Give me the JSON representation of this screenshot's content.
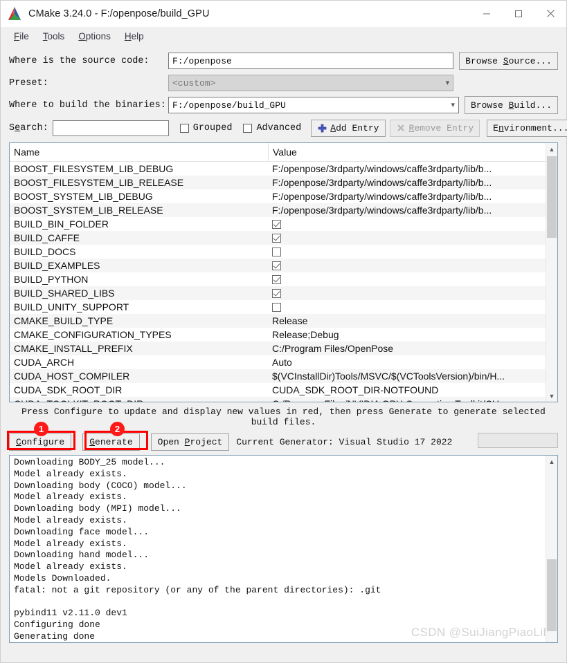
{
  "window": {
    "title": "CMake 3.24.0 - F:/openpose/build_GPU",
    "logo_icon": "cmake-logo-icon",
    "controls": [
      {
        "name": "minimize-button",
        "icon": "minimize-icon"
      },
      {
        "name": "maximize-button",
        "icon": "maximize-icon"
      },
      {
        "name": "close-button",
        "icon": "close-icon"
      }
    ]
  },
  "menubar": {
    "items": [
      {
        "label": "File",
        "mnemonic": "F"
      },
      {
        "label": "Tools",
        "mnemonic": "T"
      },
      {
        "label": "Options",
        "mnemonic": "O"
      },
      {
        "label": "Help",
        "mnemonic": "H"
      }
    ]
  },
  "form": {
    "source_label": "Where is the source code:",
    "source_value": "F:/openpose",
    "browse_source_label": "Browse Source...",
    "browse_source_mnemonic": "S",
    "preset_label": "Preset:",
    "preset_value": "<custom>",
    "build_label": "Where to build the binaries:",
    "build_value": "F:/openpose/build_GPU",
    "browse_build_label": "Browse Build...",
    "browse_build_mnemonic": "B",
    "search_label": "Search:",
    "search_mnemonic": "e",
    "search_value": "",
    "search_placeholder": "",
    "grouped_label": "Grouped",
    "grouped_checked": false,
    "advanced_label": "Advanced",
    "advanced_checked": false,
    "add_entry_label": "Add Entry",
    "add_entry_mnemonic": "A",
    "add_entry_icon": "plus-icon",
    "remove_entry_label": "Remove Entry",
    "remove_entry_mnemonic": "R",
    "remove_entry_icon": "remove-x-icon",
    "remove_entry_disabled": true,
    "environment_label": "Environment...",
    "environment_mnemonic": "n"
  },
  "cache_table": {
    "columns": [
      "Name",
      "Value"
    ],
    "rows": [
      {
        "name": "BOOST_FILESYSTEM_LIB_DEBUG",
        "type": "text",
        "value": "F:/openpose/3rdparty/windows/caffe3rdparty/lib/b..."
      },
      {
        "name": "BOOST_FILESYSTEM_LIB_RELEASE",
        "type": "text",
        "value": "F:/openpose/3rdparty/windows/caffe3rdparty/lib/b..."
      },
      {
        "name": "BOOST_SYSTEM_LIB_DEBUG",
        "type": "text",
        "value": "F:/openpose/3rdparty/windows/caffe3rdparty/lib/b..."
      },
      {
        "name": "BOOST_SYSTEM_LIB_RELEASE",
        "type": "text",
        "value": "F:/openpose/3rdparty/windows/caffe3rdparty/lib/b..."
      },
      {
        "name": "BUILD_BIN_FOLDER",
        "type": "checkbox",
        "value": true
      },
      {
        "name": "BUILD_CAFFE",
        "type": "checkbox",
        "value": true
      },
      {
        "name": "BUILD_DOCS",
        "type": "checkbox",
        "value": false
      },
      {
        "name": "BUILD_EXAMPLES",
        "type": "checkbox",
        "value": true
      },
      {
        "name": "BUILD_PYTHON",
        "type": "checkbox",
        "value": true
      },
      {
        "name": "BUILD_SHARED_LIBS",
        "type": "checkbox",
        "value": true
      },
      {
        "name": "BUILD_UNITY_SUPPORT",
        "type": "checkbox",
        "value": false
      },
      {
        "name": "CMAKE_BUILD_TYPE",
        "type": "text",
        "value": "Release"
      },
      {
        "name": "CMAKE_CONFIGURATION_TYPES",
        "type": "text",
        "value": "Release;Debug"
      },
      {
        "name": "CMAKE_INSTALL_PREFIX",
        "type": "text",
        "value": "C:/Program Files/OpenPose"
      },
      {
        "name": "CUDA_ARCH",
        "type": "text",
        "value": "Auto"
      },
      {
        "name": "CUDA_HOST_COMPILER",
        "type": "text",
        "value": "$(VCInstallDir)Tools/MSVC/$(VCToolsVersion)/bin/H..."
      },
      {
        "name": "CUDA_SDK_ROOT_DIR",
        "type": "text",
        "value": "CUDA_SDK_ROOT_DIR-NOTFOUND"
      },
      {
        "name": "CUDA_TOOLKIT_ROOT_DIR",
        "type": "text",
        "value": "C:/Program Files/NVIDIA GPU Computing Toolkit/CU"
      }
    ]
  },
  "hint": {
    "line1": "Press Configure to update and display new values in red, then press Generate to generate selected",
    "line2": "build files."
  },
  "actions": {
    "configure_label": "Configure",
    "configure_mnemonic": "C",
    "generate_label": "Generate",
    "generate_mnemonic": "G",
    "open_project_label": "Open Project",
    "open_project_mnemonic": "P",
    "current_generator": "Current Generator: Visual Studio 17 2022",
    "progress_value": ""
  },
  "annotations": [
    {
      "badge": "1",
      "target": "configure-button"
    },
    {
      "badge": "2",
      "target": "generate-button"
    }
  ],
  "log": {
    "lines": [
      "Downloading BODY_25 model...",
      "Model already exists.",
      "Downloading body (COCO) model...",
      "Model already exists.",
      "Downloading body (MPI) model...",
      "Model already exists.",
      "Downloading face model...",
      "Model already exists.",
      "Downloading hand model...",
      "Model already exists.",
      "Models Downloaded.",
      "fatal: not a git repository (or any of the parent directories): .git",
      "",
      "pybind11 v2.11.0 dev1",
      "Configuring done",
      "Generating done"
    ],
    "watermark": "CSDN @SuiJiangPiaoLiM"
  },
  "colors": {
    "accent_red": "#ff0000",
    "window_bg": "#f0f0f0",
    "field_bg": "#ffffff",
    "row_alt": "#f5f5f5",
    "border_blue": "#7d9db5"
  }
}
